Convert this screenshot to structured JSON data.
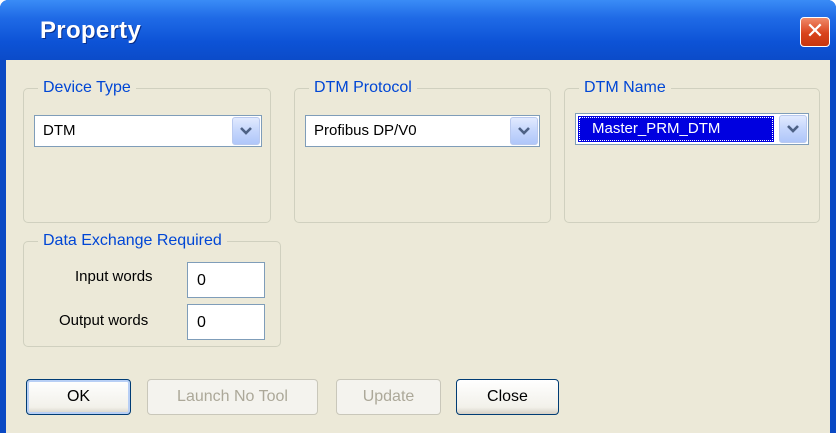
{
  "window": {
    "title": "Property",
    "close_glyph": "✕"
  },
  "device_type": {
    "label": "Device Type",
    "value": "DTM"
  },
  "dtm_protocol": {
    "label": "DTM Protocol",
    "value": "Profibus DP/V0"
  },
  "dtm_name": {
    "label": "DTM Name",
    "value": "Master_PRM_DTM"
  },
  "data_exchange": {
    "label": "Data Exchange Required",
    "input_label": "Input words",
    "input_value": "0",
    "output_label": "Output words",
    "output_value": "0"
  },
  "buttons": {
    "ok": "OK",
    "launch": "Launch No Tool",
    "update": "Update",
    "close": "Close"
  },
  "colors": {
    "title_bar": "#0b4bc9",
    "group_label": "#0046d5",
    "selection": "#0000e0",
    "close_red": "#d9431c"
  }
}
